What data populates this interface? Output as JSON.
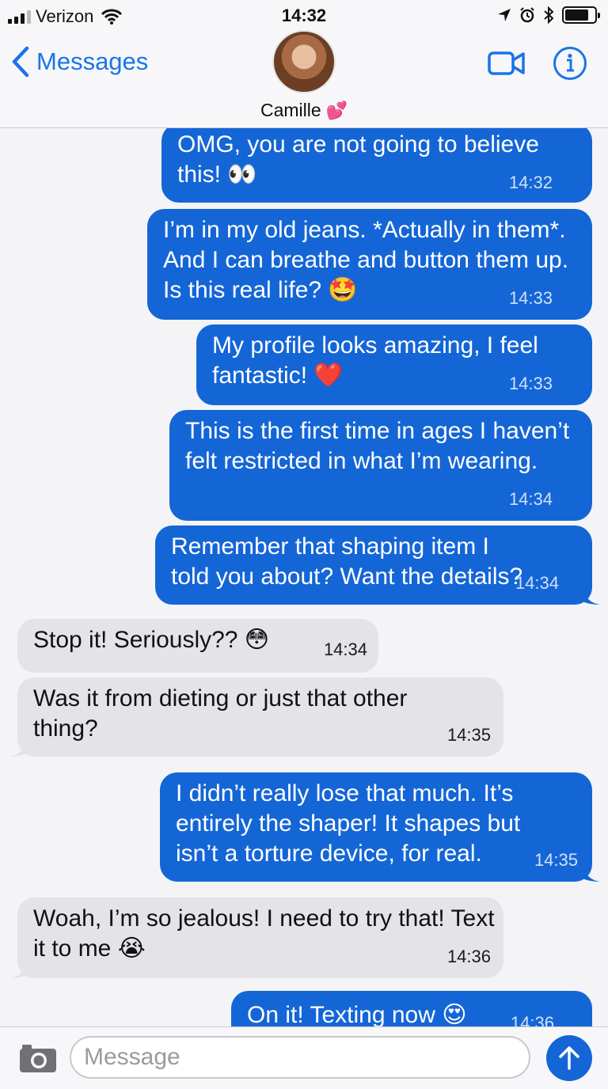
{
  "status_bar": {
    "carrier": "Verizon",
    "time": "14:32"
  },
  "nav": {
    "back_label": "Messages",
    "contact_name": "Camille",
    "contact_emoji": "💕"
  },
  "messages": [
    {
      "direction": "out",
      "text": "OMG, you are not going to believe this! 👀",
      "time": "14:32"
    },
    {
      "direction": "out",
      "text": "I’m in my old jeans. *Actually in them*. And I can breathe and button them up. Is this real life? 🤩",
      "time": "14:33"
    },
    {
      "direction": "out",
      "text": "My profile looks amazing, I feel fantastic! ❤️",
      "time": "14:33"
    },
    {
      "direction": "out",
      "text": "This is the first time in ages I haven’t felt restricted in what I’m wearing.",
      "time": "14:34"
    },
    {
      "direction": "out",
      "text": "Remember that shaping item I told you about? Want the details?",
      "time": "14:34"
    },
    {
      "direction": "in",
      "text": "Stop it! Seriously?? 😳",
      "time": "14:34"
    },
    {
      "direction": "in",
      "text": "Was it from dieting or just that other thing?",
      "time": "14:35"
    },
    {
      "direction": "out",
      "text": "I didn’t really lose that much. It’s entirely the shaper! It shapes but isn’t a torture device, for real.",
      "time": "14:35"
    },
    {
      "direction": "in",
      "text": "Woah, I’m so jealous! I need to try that! Text it to me 😭",
      "time": "14:36"
    },
    {
      "direction": "out",
      "text": "On it! Texting now 😍",
      "time": "14:36"
    }
  ],
  "composer": {
    "placeholder": "Message"
  },
  "colors": {
    "accent": "#1a74e8",
    "outgoing_bubble": "#1466d6",
    "incoming_bubble": "#e3e3e8"
  },
  "icons": [
    "signal-icon",
    "wifi-icon",
    "location-icon",
    "alarm-icon",
    "bluetooth-icon",
    "battery-icon",
    "chevron-left-icon",
    "video-call-icon",
    "info-icon",
    "camera-icon",
    "send-arrow-icon"
  ]
}
